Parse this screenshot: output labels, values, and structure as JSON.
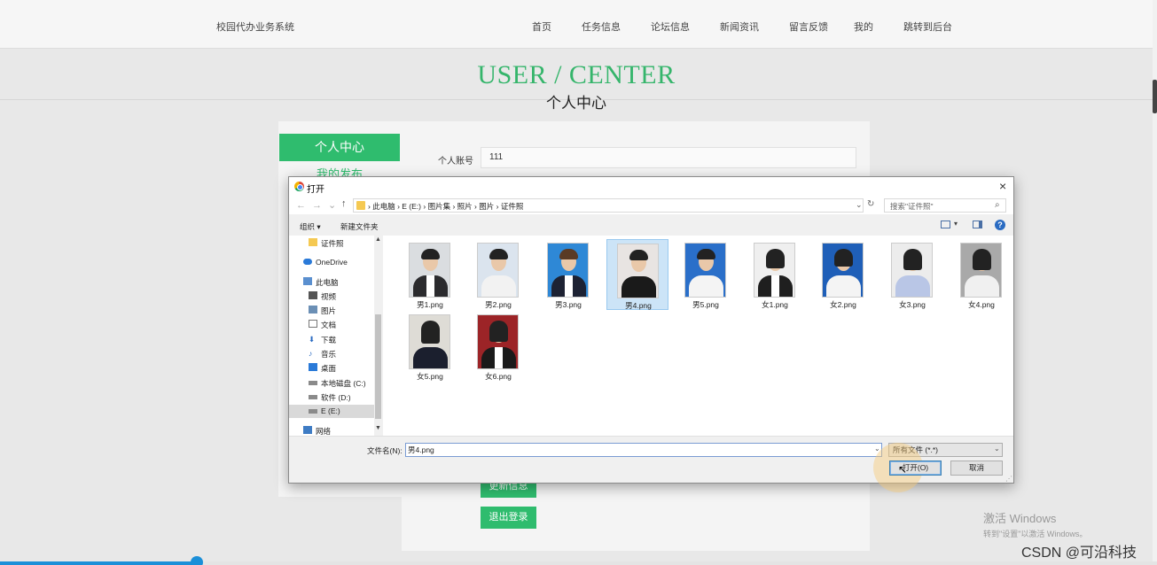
{
  "nav": {
    "brand": "校园代办业务系统",
    "links": [
      "首页",
      "任务信息",
      "论坛信息",
      "新闻资讯",
      "留言反馈",
      "我的",
      "跳转到后台"
    ]
  },
  "hero": {
    "title": "USER / CENTER",
    "subtitle": "个人中心"
  },
  "sidebar": {
    "active": "个人中心",
    "item2": "我的发布"
  },
  "form": {
    "account_label": "个人账号",
    "account_value": "111",
    "update_label": "更新信息",
    "logout_label": "退出登录"
  },
  "dialog": {
    "title": "打开",
    "close": "×",
    "nav_back": "←",
    "nav_forward": "→",
    "nav_recent": "⌄",
    "nav_up": "↑",
    "breadcrumbs": [
      "此电脑",
      "E (E:)",
      "图片集",
      "照片",
      "图片",
      "证件照"
    ],
    "search_placeholder": "搜索\"证件照\"",
    "toolbar": {
      "organize": "组织 ▾",
      "new_folder": "新建文件夹",
      "help": "?"
    },
    "tree": [
      {
        "label": "证件照",
        "icon": "folder-icon"
      },
      {
        "label": "OneDrive",
        "icon": "cloud-icon"
      },
      {
        "label": "此电脑",
        "icon": "computer-icon"
      },
      {
        "label": "视频",
        "icon": "video-icon"
      },
      {
        "label": "图片",
        "icon": "picture-icon"
      },
      {
        "label": "文档",
        "icon": "document-icon"
      },
      {
        "label": "下载",
        "icon": "download-icon"
      },
      {
        "label": "音乐",
        "icon": "music-icon"
      },
      {
        "label": "桌面",
        "icon": "desktop-icon"
      },
      {
        "label": "本地磁盘 (C:)",
        "icon": "drive-icon"
      },
      {
        "label": "软件 (D:)",
        "icon": "drive-icon"
      },
      {
        "label": "E (E:)",
        "icon": "drive-icon"
      },
      {
        "label": "网络",
        "icon": "network-icon"
      }
    ],
    "selected_tree_item": "E (E:)",
    "files": [
      {
        "name": "男1.png",
        "bg": "#dadde0",
        "outfit": "#2b2b2e"
      },
      {
        "name": "男2.png",
        "bg": "#dbe4ee",
        "outfit": "#f2f2f2"
      },
      {
        "name": "男3.png",
        "bg": "#2e88d6",
        "outfit": "#1d2233"
      },
      {
        "name": "男4.png",
        "bg": "#e8e4e2",
        "outfit": "#1a1a1a"
      },
      {
        "name": "男5.png",
        "bg": "#2a6fc9",
        "outfit": "#f4f4f4"
      },
      {
        "name": "女1.png",
        "bg": "#efefef",
        "outfit": "#1f1f1f"
      },
      {
        "name": "女2.png",
        "bg": "#1f5fb8",
        "outfit": "#f4f4f4"
      },
      {
        "name": "女3.png",
        "bg": "#ececec",
        "outfit": "#b9c6e6"
      },
      {
        "name": "女4.png",
        "bg": "#a9a9a9",
        "outfit": "#f0f0f0"
      },
      {
        "name": "女5.png",
        "bg": "#dedcd6",
        "outfit": "#1b1f2e"
      },
      {
        "name": "女6.png",
        "bg": "#9c2427",
        "outfit": "#1a1a1a"
      }
    ],
    "selected_file": "男4.png",
    "filename_label": "文件名(N):",
    "filename_value": "男4.png",
    "filetype_value": "所有文件 (*.*)",
    "open_button": "打开(O)",
    "cancel_button": "取消"
  },
  "system": {
    "activate_line1": "激活 Windows",
    "activate_line2": "转到\"设置\"以激活 Windows。",
    "watermark": "CSDN @可沿科技"
  },
  "video_progress": 0.17,
  "colors": {
    "accent_green": "#2fbc6e",
    "hero_green": "#35b56b",
    "progress_blue": "#1b8fd8"
  }
}
